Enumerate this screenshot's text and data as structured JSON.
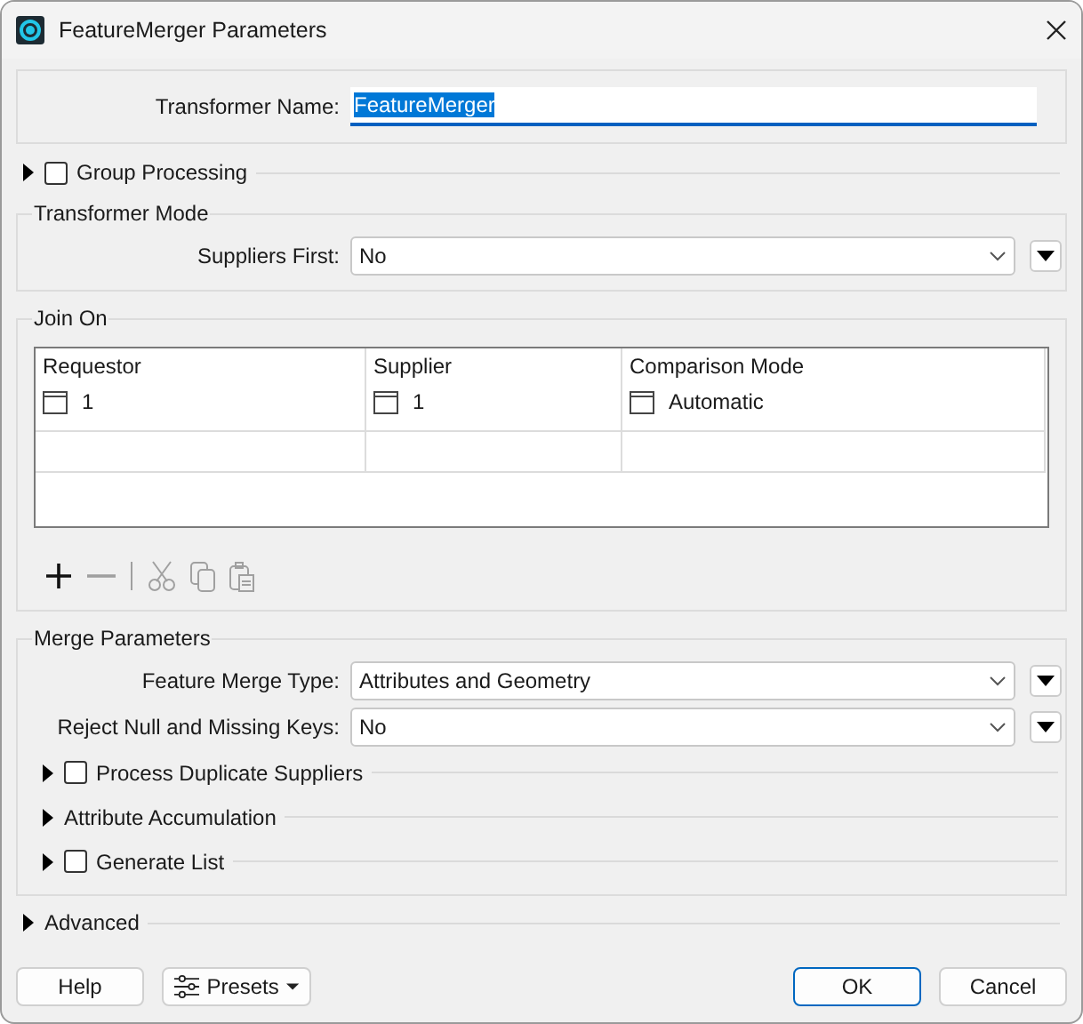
{
  "window": {
    "title": "FeatureMerger Parameters"
  },
  "name_field": {
    "label": "Transformer Name:",
    "value": "FeatureMerger",
    "selected": true
  },
  "group_processing": {
    "label": "Group Processing",
    "checked": false,
    "expanded": false
  },
  "transformer_mode": {
    "title": "Transformer Mode",
    "params": [
      {
        "label": "Suppliers First:",
        "value": "No"
      }
    ]
  },
  "join_on": {
    "title": "Join On",
    "columns": [
      "Requestor",
      "Supplier",
      "Comparison Mode"
    ],
    "rows": [
      [
        "1",
        "1",
        "Automatic"
      ]
    ],
    "toolbar": [
      {
        "kind": "add",
        "disabled": false
      },
      {
        "kind": "remove",
        "disabled": true
      },
      {
        "kind": "separator",
        "disabled": true
      },
      {
        "kind": "cut",
        "disabled": true
      },
      {
        "kind": "copy",
        "disabled": true
      },
      {
        "kind": "paste",
        "disabled": true
      }
    ]
  },
  "merge_parameters": {
    "title": "Merge Parameters",
    "params": [
      {
        "label": "Feature Merge Type:",
        "value": "Attributes and Geometry"
      },
      {
        "label": "Reject Null and Missing Keys:",
        "value": "No"
      }
    ],
    "options": [
      {
        "kind": "checkbox",
        "label": "Process Duplicate Suppliers",
        "checked": false,
        "expanded": false
      },
      {
        "kind": "plain",
        "label": "Attribute Accumulation",
        "expanded": false
      },
      {
        "kind": "checkbox",
        "label": "Generate List",
        "checked": false,
        "expanded": false
      }
    ]
  },
  "advanced": {
    "label": "Advanced",
    "expanded": false
  },
  "buttons": [
    {
      "kind": "plain",
      "label": "Help"
    },
    {
      "kind": "menu",
      "label": "Presets"
    },
    {
      "kind": "spacer"
    },
    {
      "kind": "default",
      "label": "OK"
    },
    {
      "kind": "plain",
      "label": "Cancel"
    }
  ]
}
